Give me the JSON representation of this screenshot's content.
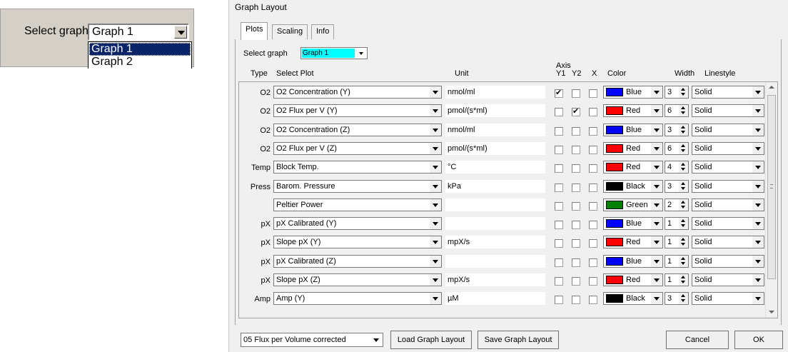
{
  "inset": {
    "label": "Select graph",
    "selected": "Graph 1",
    "options": [
      "Graph 1",
      "Graph 2"
    ]
  },
  "dialog": {
    "title": "Graph Layout",
    "tabs": [
      "Plots",
      "Scaling",
      "Info"
    ],
    "select_graph_label": "Select graph",
    "select_graph_value": "Graph 1",
    "headers": {
      "type": "Type",
      "select_plot": "Select Plot",
      "unit": "Unit",
      "axis": "Axis",
      "y1": "Y1",
      "y2": "Y2",
      "x": "X",
      "color": "Color",
      "width": "Width",
      "linestyle": "Linestyle"
    },
    "rows": [
      {
        "type": "O2",
        "plot": "O2 Concentration (Y)",
        "unit": "nmol/ml",
        "y1": true,
        "y2": false,
        "x": false,
        "color": "Blue",
        "color_hex": "#0000ff",
        "width": "3",
        "linestyle": "Solid"
      },
      {
        "type": "O2",
        "plot": "O2 Flux per V (Y)",
        "unit": "pmol/(s*ml)",
        "y1": false,
        "y2": true,
        "x": false,
        "color": "Red",
        "color_hex": "#ff0000",
        "width": "6",
        "linestyle": "Solid"
      },
      {
        "type": "O2",
        "plot": "O2 Concentration (Z)",
        "unit": "nmol/ml",
        "y1": false,
        "y2": false,
        "x": false,
        "color": "Blue",
        "color_hex": "#0000ff",
        "width": "3",
        "linestyle": "Solid"
      },
      {
        "type": "O2",
        "plot": "O2 Flux per V (Z)",
        "unit": "pmol/(s*ml)",
        "y1": false,
        "y2": false,
        "x": false,
        "color": "Red",
        "color_hex": "#ff0000",
        "width": "6",
        "linestyle": "Solid"
      },
      {
        "type": "Temp",
        "plot": "Block Temp.",
        "unit": "°C",
        "y1": false,
        "y2": false,
        "x": false,
        "color": "Red",
        "color_hex": "#ff0000",
        "width": "4",
        "linestyle": "Solid"
      },
      {
        "type": "Press",
        "plot": "Barom. Pressure",
        "unit": "kPa",
        "y1": false,
        "y2": false,
        "x": false,
        "color": "Black",
        "color_hex": "#000000",
        "width": "3",
        "linestyle": "Solid"
      },
      {
        "type": "",
        "plot": "Peltier Power",
        "unit": "",
        "y1": false,
        "y2": false,
        "x": false,
        "color": "Green",
        "color_hex": "#008000",
        "width": "2",
        "linestyle": "Solid"
      },
      {
        "type": "pX",
        "plot": "pX Calibrated (Y)",
        "unit": "",
        "y1": false,
        "y2": false,
        "x": false,
        "color": "Blue",
        "color_hex": "#0000ff",
        "width": "1",
        "linestyle": "Solid"
      },
      {
        "type": "pX",
        "plot": "Slope pX (Y)",
        "unit": "mpX/s",
        "y1": false,
        "y2": false,
        "x": false,
        "color": "Red",
        "color_hex": "#ff0000",
        "width": "1",
        "linestyle": "Solid"
      },
      {
        "type": "pX",
        "plot": "pX Calibrated (Z)",
        "unit": "",
        "y1": false,
        "y2": false,
        "x": false,
        "color": "Blue",
        "color_hex": "#0000ff",
        "width": "1",
        "linestyle": "Solid"
      },
      {
        "type": "pX",
        "plot": "Slope pX (Z)",
        "unit": "mpX/s",
        "y1": false,
        "y2": false,
        "x": false,
        "color": "Red",
        "color_hex": "#ff0000",
        "width": "1",
        "linestyle": "Solid"
      },
      {
        "type": "Amp",
        "plot": "Amp (Y)",
        "unit": "µM",
        "y1": false,
        "y2": false,
        "x": false,
        "color": "Black",
        "color_hex": "#000000",
        "width": "3",
        "linestyle": "Solid"
      }
    ],
    "layout_preset": "05 Flux per Volume corrected",
    "buttons": {
      "load": "Load Graph Layout",
      "save": "Save Graph Layout",
      "cancel": "Cancel",
      "ok": "OK"
    }
  }
}
